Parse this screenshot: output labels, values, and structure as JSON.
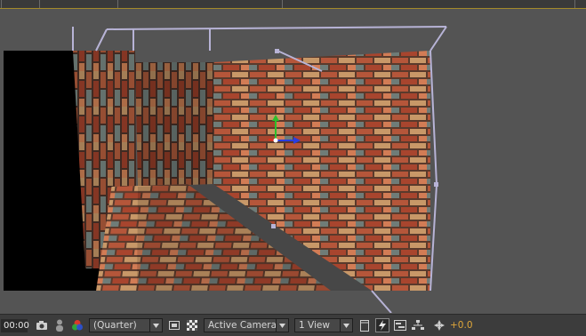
{
  "status_bar": {
    "timecode": "00:00",
    "resolution": "(Quarter)",
    "camera_view": "Active Camera",
    "view_layout": "1 View",
    "exposure": "+0.0"
  },
  "colors": {
    "viewer_bg": "#545454",
    "status_bg": "#3c3c3c",
    "accent_orange": "#e0a73a",
    "camera_wireframe": "#b7b3d6",
    "axis_x": "#e03020",
    "axis_y": "#2bc02b",
    "axis_z": "#2a3ee0"
  },
  "icons": [
    "snapshot-icon",
    "show-snapshot-icon",
    "color-channels-icon",
    "dropdown-arrow-icon",
    "region-of-interest-icon",
    "transparency-grid-icon",
    "fast-previews-icon",
    "timeline-icon",
    "flowchart-icon",
    "exposure-reset-icon"
  ]
}
